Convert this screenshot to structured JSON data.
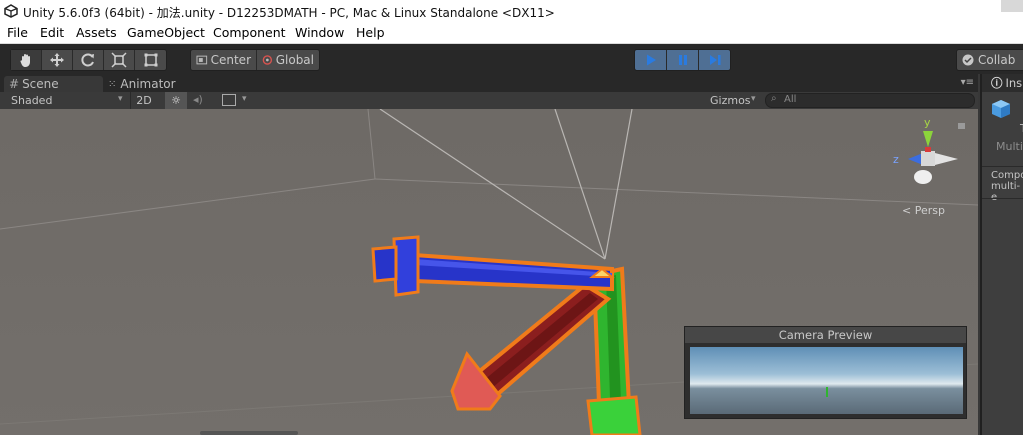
{
  "window": {
    "title": "Unity 5.6.0f3 (64bit) - 加法.unity - D12253DMATH - PC, Mac & Linux Standalone <DX11>"
  },
  "menu": [
    "File",
    "Edit",
    "Assets",
    "GameObject",
    "Component",
    "Window",
    "Help"
  ],
  "toolbar": {
    "tools": [
      "hand-tool-icon",
      "move-tool-icon",
      "rotate-tool-icon",
      "scale-tool-icon",
      "rect-tool-icon"
    ],
    "pivot_label": "Center",
    "space_label": "Global",
    "collab_label": "Collab"
  },
  "tabs": {
    "scene": "Scene",
    "animator": "Animator",
    "inspector": "Ins"
  },
  "scene_bar": {
    "shading": "Shaded",
    "mode_2d": "2D",
    "gizmos": "Gizmos",
    "search_placeholder": "All"
  },
  "gizmo": {
    "y": "y",
    "z": "z",
    "persp": "Persp"
  },
  "camera_preview": {
    "title": "Camera Preview"
  },
  "inspector": {
    "line1": "T",
    "line2": "Multip",
    "line3": "Compo",
    "line4": "multi-e"
  },
  "colors": {
    "accent_play": "#4f6f94",
    "selection_outline": "#f07b1a",
    "arm_blue": "#2734c9",
    "arm_red": "#8b1e1e",
    "arm_green": "#2fb52f"
  }
}
